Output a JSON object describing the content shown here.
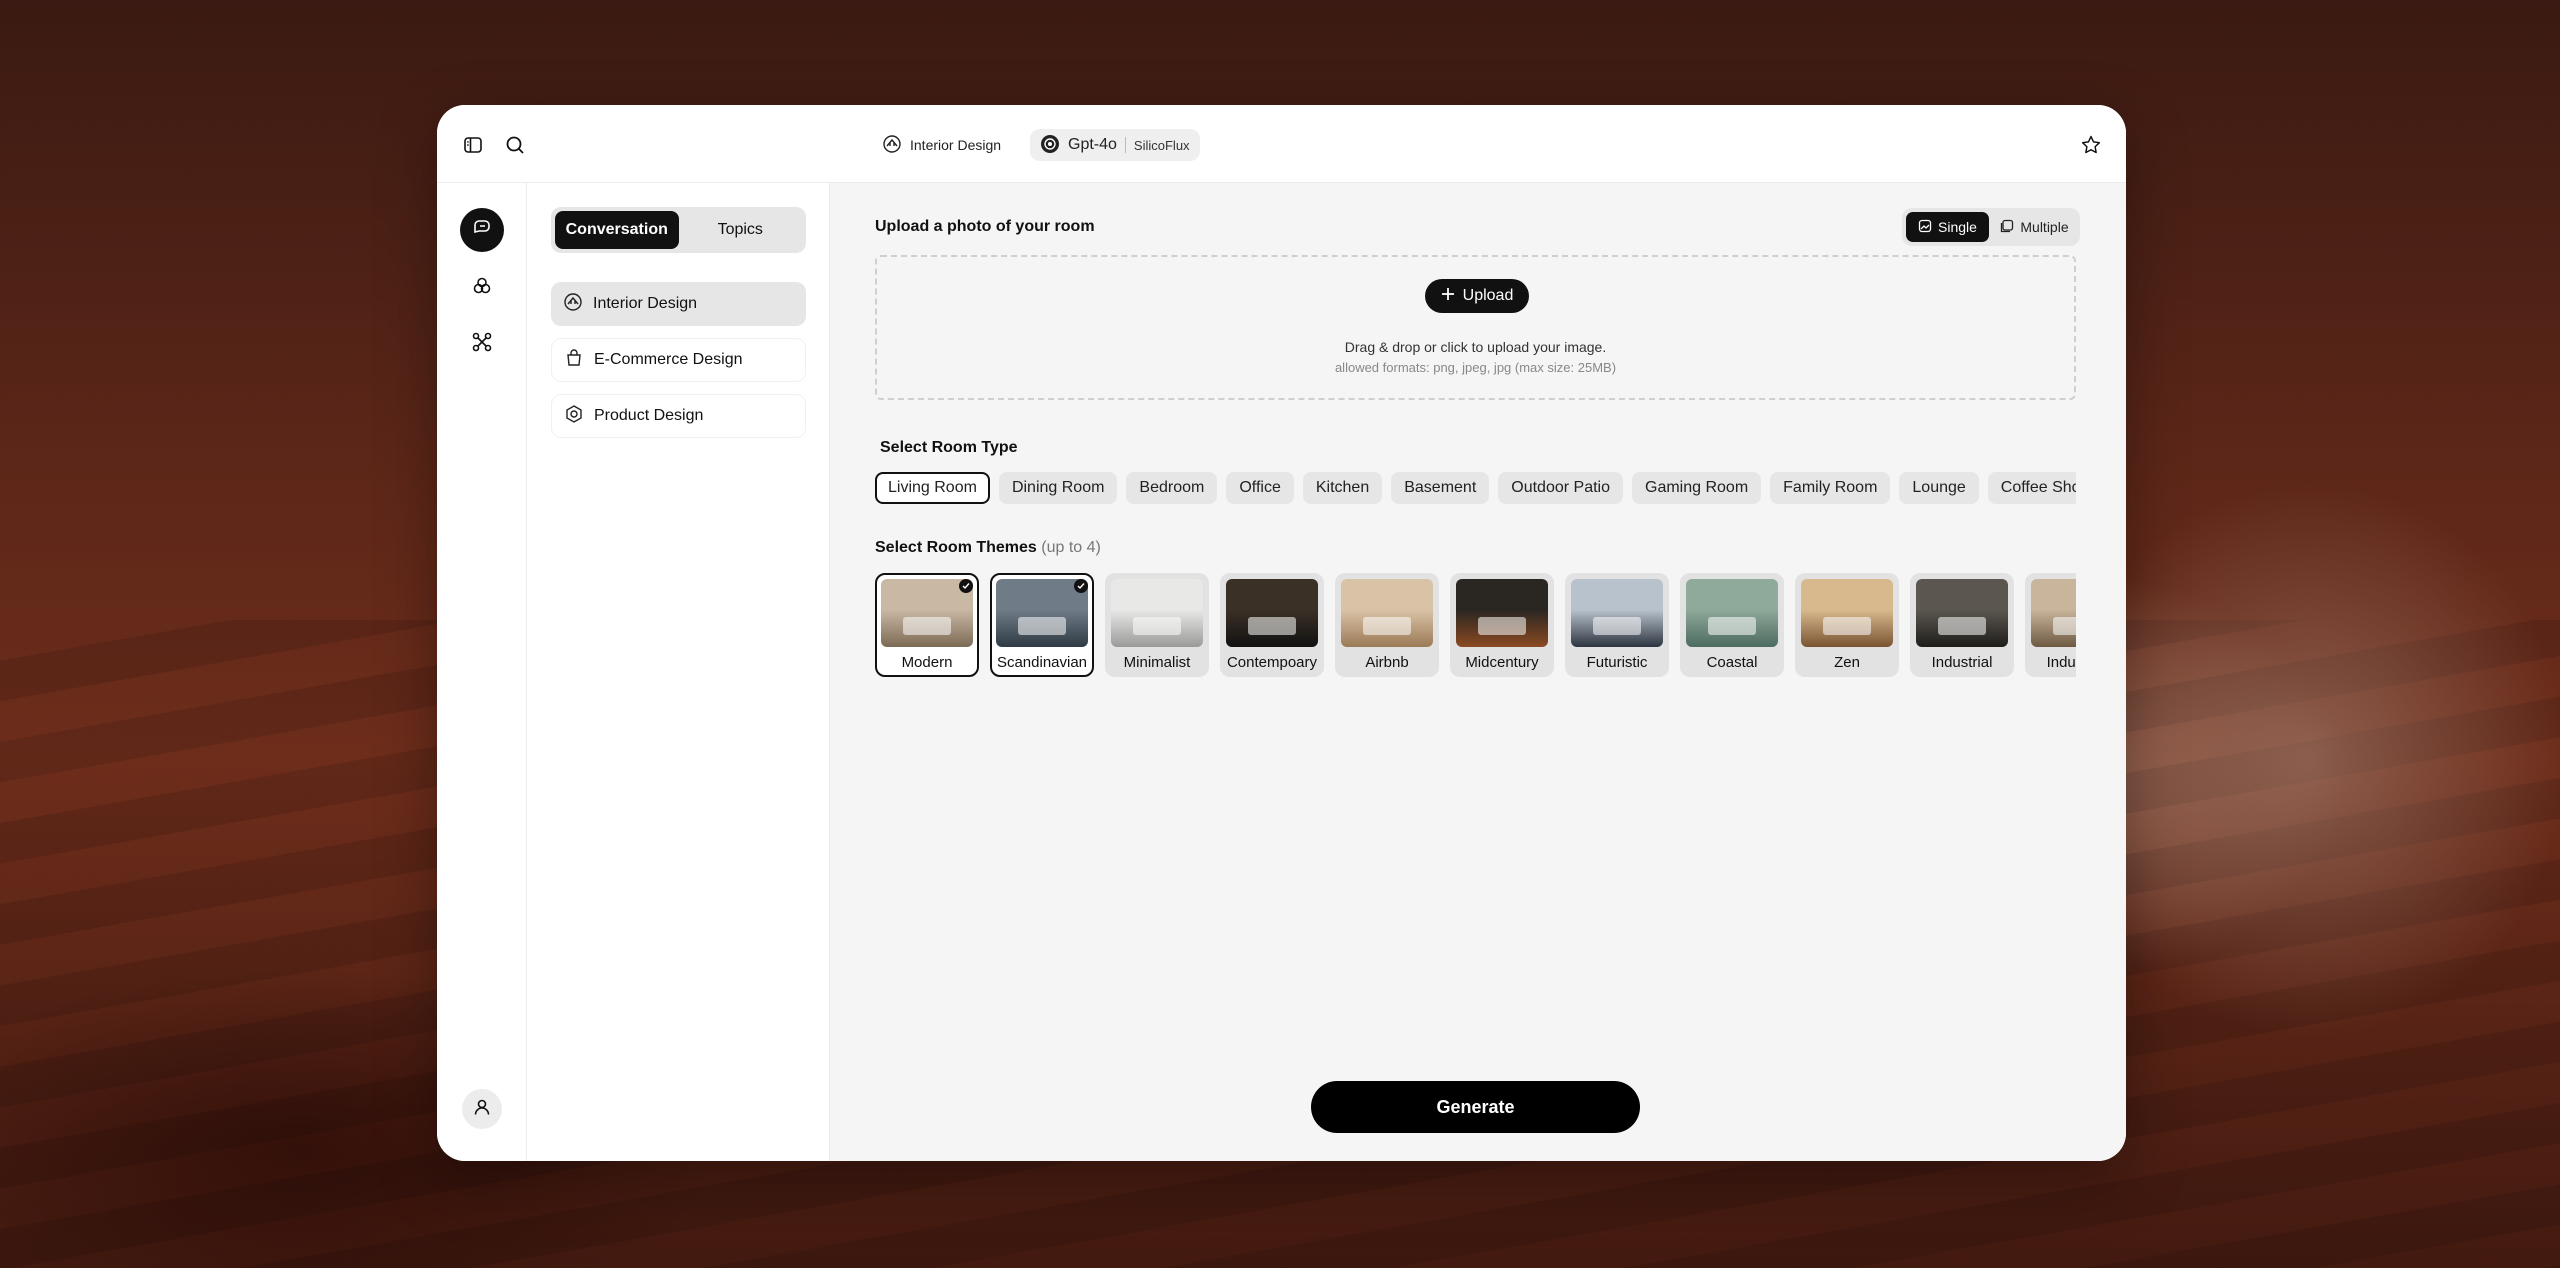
{
  "topbar": {
    "chip_interior": "Interior Design",
    "chip_model": "Gpt-4o",
    "chip_provider": "SilicoFlux"
  },
  "sidebar": {
    "tabs": [
      "Conversation",
      "Topics"
    ],
    "active_tab": 0,
    "items": [
      {
        "label": "Interior Design",
        "icon": "interior-icon",
        "active": true
      },
      {
        "label": "E-Commerce Design",
        "icon": "shopping-bag-icon",
        "active": false
      },
      {
        "label": "Product Design",
        "icon": "box-icon",
        "active": false
      }
    ]
  },
  "main": {
    "upload_heading": "Upload a photo of your room",
    "mode": [
      "Single",
      "Multiple"
    ],
    "active_mode": 0,
    "upload_button": "Upload",
    "drop_text": "Drag & drop or click to upload your image.",
    "drop_formats": "allowed formats: png, jpeg, jpg (max size: 25MB)",
    "room_type_heading": "Select Room Type",
    "room_types": [
      "Living Room",
      "Dining Room",
      "Bedroom",
      "Office",
      "Kitchen",
      "Basement",
      "Outdoor Patio",
      "Gaming Room",
      "Family Room",
      "Lounge",
      "Coffee Shop"
    ],
    "active_room_type": 0,
    "themes_heading": "Select Room Themes",
    "themes_hint": "(up to 4)",
    "themes": [
      {
        "label": "Modern",
        "selected": true,
        "c1": "#c9b9a4",
        "c2": "#7c6a55"
      },
      {
        "label": "Scandinavian",
        "selected": true,
        "c1": "#6f7b86",
        "c2": "#2e3a44"
      },
      {
        "label": "Minimalist",
        "selected": false,
        "c1": "#e8e8e6",
        "c2": "#9a9a98"
      },
      {
        "label": "Contempoary",
        "selected": false,
        "c1": "#3b3026",
        "c2": "#111111"
      },
      {
        "label": "Airbnb",
        "selected": false,
        "c1": "#d9c3a6",
        "c2": "#9b7a56"
      },
      {
        "label": "Midcentury",
        "selected": false,
        "c1": "#2a2622",
        "c2": "#8b4a22"
      },
      {
        "label": "Futuristic",
        "selected": false,
        "c1": "#b8c2cc",
        "c2": "#2c3440"
      },
      {
        "label": "Coastal",
        "selected": false,
        "c1": "#8fa99a",
        "c2": "#4d6b60"
      },
      {
        "label": "Zen",
        "selected": false,
        "c1": "#d8b98e",
        "c2": "#7a5432"
      },
      {
        "label": "Industrial",
        "selected": false,
        "c1": "#5b5750",
        "c2": "#1f1d1a"
      },
      {
        "label": "Industrial",
        "selected": false,
        "c1": "#c8b59b",
        "c2": "#6e5a43"
      }
    ],
    "generate_button": "Generate"
  },
  "colors": {
    "accent": "#111111",
    "panel": "#f5f5f5",
    "pill": "#e6e6e6"
  }
}
